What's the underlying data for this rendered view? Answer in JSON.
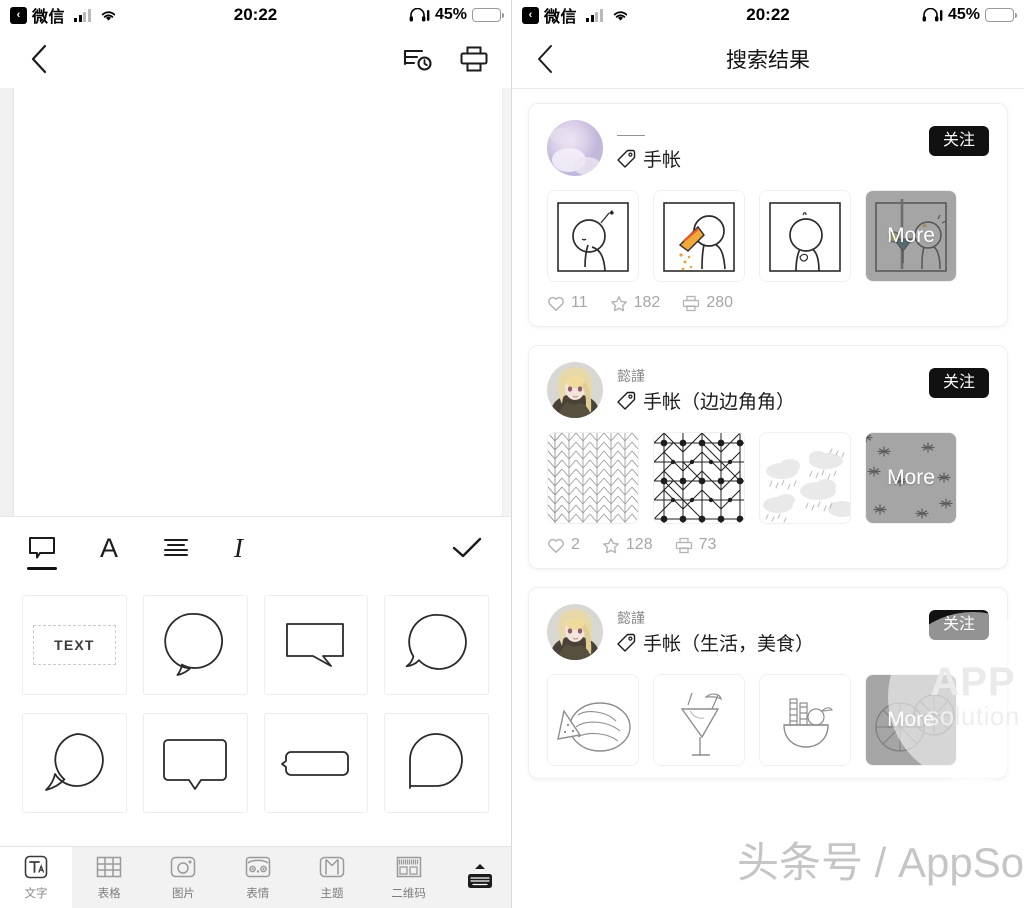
{
  "status_bar": {
    "back_app_label": "微信",
    "back_chevron": "‹",
    "time": "20:22",
    "battery_percent": "45%",
    "battery_level": 45,
    "battery_color": "#FBCD2F",
    "signal_icon": "cellular-signal-icon",
    "wifi_icon": "wifi-icon",
    "headphones_icon": "headphones-icon"
  },
  "left_screen": {
    "header": {
      "back_icon": "back-chevron-icon",
      "history_icon": "history-list-clock-icon",
      "print_icon": "printer-icon"
    },
    "format_toolbar": {
      "items": [
        {
          "name": "speech-bubble",
          "glyph": "bubble",
          "active": true
        },
        {
          "name": "font-style",
          "glyph": "A",
          "active": false
        },
        {
          "name": "text-align",
          "glyph": "align",
          "active": false
        },
        {
          "name": "italic",
          "glyph": "I",
          "active": false
        }
      ],
      "confirm_label": "✓"
    },
    "shapes": [
      {
        "name": "text-box",
        "label": "TEXT",
        "type": "textbox"
      },
      {
        "name": "round-bubble-bottom-tail",
        "label": "",
        "type": "round-tail-bottom"
      },
      {
        "name": "rect-bubble-right-tail",
        "label": "",
        "type": "rect-tail-right"
      },
      {
        "name": "round-bubble-left-tail",
        "label": "",
        "type": "round-tail-left"
      },
      {
        "name": "round-bubble-bottomleft-tail",
        "label": "",
        "type": "round-tail-bl"
      },
      {
        "name": "rounded-rect-bubble-bottom-tail",
        "label": "",
        "type": "rrect-tail-bottom"
      },
      {
        "name": "pill-bubble-left-tail",
        "label": "",
        "type": "pill-tail-left"
      },
      {
        "name": "teardrop-bubble",
        "label": "",
        "type": "teardrop"
      }
    ],
    "bottom_nav": {
      "items": [
        {
          "name": "text",
          "label": "文字",
          "icon": "text-tool-icon",
          "active": true
        },
        {
          "name": "table",
          "label": "表格",
          "icon": "table-grid-icon",
          "active": false
        },
        {
          "name": "image",
          "label": "图片",
          "icon": "camera-photo-icon",
          "active": false
        },
        {
          "name": "emoji",
          "label": "表情",
          "icon": "emoji-face-icon",
          "active": false
        },
        {
          "name": "theme",
          "label": "主题",
          "icon": "tshirt-theme-icon",
          "active": false
        },
        {
          "name": "qrcode",
          "label": "二维码",
          "icon": "barcode-qr-icon",
          "active": false
        }
      ],
      "keyboard_toggle": "keyboard-collapse-icon"
    }
  },
  "right_screen": {
    "header": {
      "title": "搜索结果",
      "back_icon": "back-chevron-icon"
    },
    "follow_label": "关注",
    "more_label": "More",
    "cards": [
      {
        "username": "——",
        "tag": "手帐",
        "tag_icon": "price-tag-icon",
        "avatar": "blurred-lavender-photo-avatar",
        "follow": "关注",
        "thumbs": [
          "doodle-person-drinking",
          "doodle-person-confetti",
          "doodle-person-question",
          "doodle-person-cocktail"
        ],
        "stats": [
          {
            "icon": "heart-icon",
            "value": "11"
          },
          {
            "icon": "star-icon",
            "value": "182"
          },
          {
            "icon": "print-icon",
            "value": "280"
          }
        ]
      },
      {
        "username": "懿謹",
        "tag": "手帐（边边角角）",
        "tag_icon": "price-tag-icon",
        "avatar": "anime-blonde-character-avatar",
        "follow": "关注",
        "thumbs": [
          "herringbone-chevron-pattern",
          "diamond-dot-grid-pattern",
          "rain-clouds-pattern",
          "sparkle-pattern"
        ],
        "stats": [
          {
            "icon": "heart-icon",
            "value": "2"
          },
          {
            "icon": "star-icon",
            "value": "128"
          },
          {
            "icon": "print-icon",
            "value": "73"
          }
        ]
      },
      {
        "username": "懿謹",
        "tag": "手帐（生活，美食）",
        "tag_icon": "price-tag-icon",
        "avatar": "anime-blonde-character-avatar",
        "follow": "关注",
        "thumbs": [
          "watermelon-sketch",
          "cocktail-glass-sketch",
          "fruit-bowl-sketch",
          "citrus-slices-sketch"
        ],
        "stats": []
      }
    ],
    "watermarks": {
      "circle_top": "APP",
      "circle_bottom": "solution",
      "bottom_text": "头条号 / AppSo"
    }
  }
}
